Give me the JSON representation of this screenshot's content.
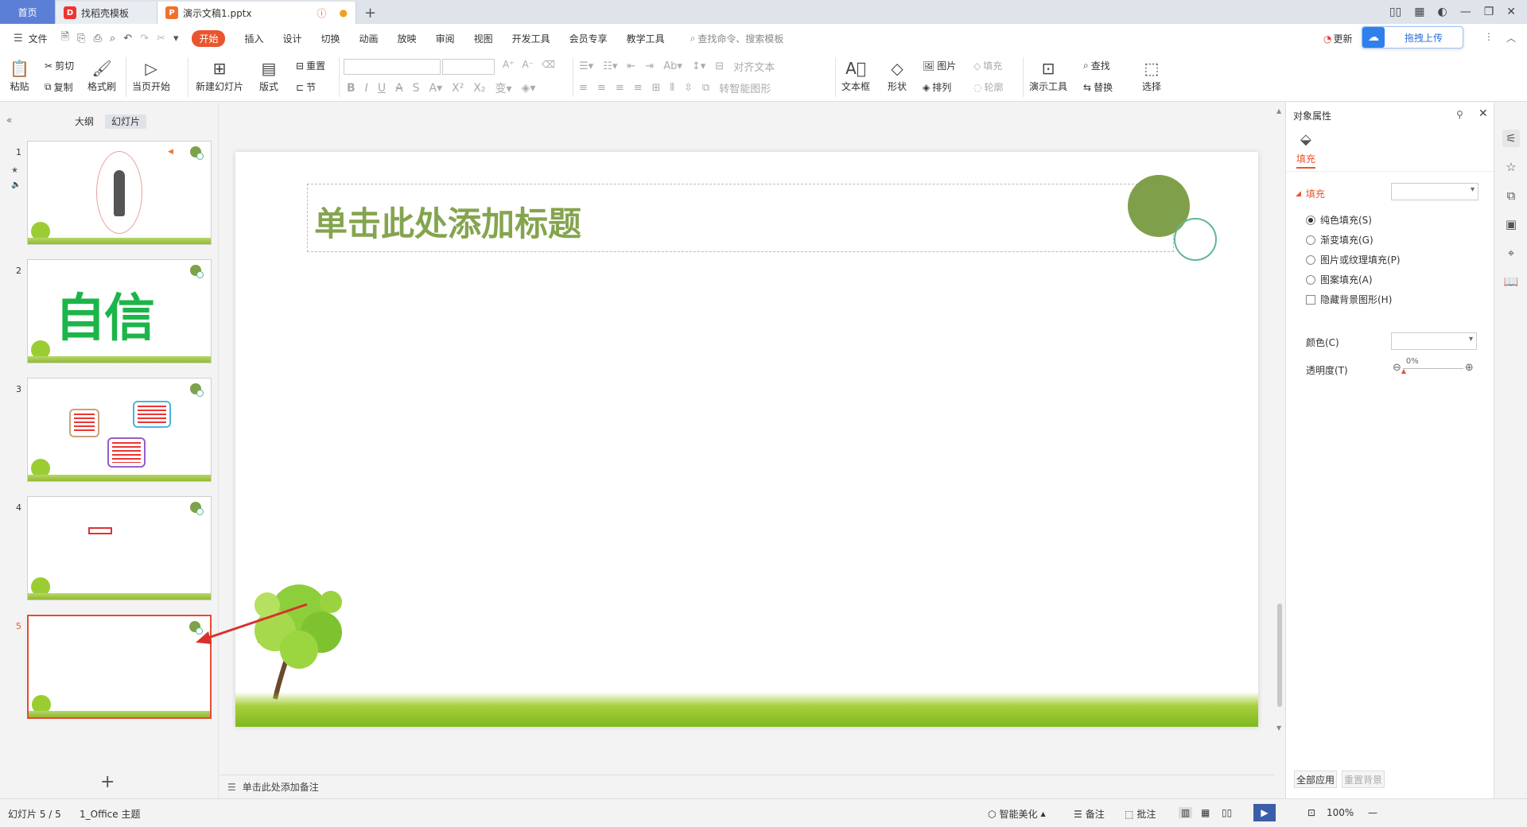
{
  "tabs": {
    "home": "首页",
    "template": "找稻壳模板",
    "doc": "演示文稿1.pptx"
  },
  "menu": {
    "file": "文件",
    "items": [
      "开始",
      "插入",
      "设计",
      "切换",
      "动画",
      "放映",
      "审阅",
      "视图",
      "开发工具",
      "会员专享",
      "教学工具"
    ],
    "search": "查找命令、搜索模板",
    "update": "更新",
    "upload": "拖拽上传"
  },
  "ribbon": {
    "paste": "粘贴",
    "cut": "剪切",
    "copy": "复制",
    "format_painter": "格式刷",
    "play_current": "当页开始",
    "new_slide": "新建幻灯片",
    "layout": "版式",
    "section": "节",
    "reset": "重置",
    "align_text": "对齐文本",
    "convert_smartart": "转智能图形",
    "textbox": "文本框",
    "shape": "形状",
    "picture": "图片",
    "arrange": "排列",
    "fill": "填充",
    "outline": "轮廓",
    "present_tool": "演示工具",
    "find": "查找",
    "replace": "替换",
    "select": "选择"
  },
  "left_pane": {
    "outline_tab": "大纲",
    "slides_tab": "幻灯片",
    "slide_numbers": [
      "1",
      "2",
      "3",
      "4",
      "5"
    ],
    "slide2_text": "自信",
    "add": "+"
  },
  "slide": {
    "title_placeholder": "单击此处添加标题"
  },
  "notes": {
    "placeholder": "单击此处添加备注"
  },
  "right_panel": {
    "title": "对象属性",
    "fill_tab": "填充",
    "section": "填充",
    "options": [
      "纯色填充(S)",
      "渐变填充(G)",
      "图片或纹理填充(P)",
      "图案填充(A)"
    ],
    "hide_bg": "隐藏背景图形(H)",
    "color_label": "颜色(C)",
    "transparency_label": "透明度(T)",
    "transparency_value": "0%",
    "apply_all": "全部应用",
    "reset_bg": "重置背景"
  },
  "status": {
    "slide_count": "幻灯片 5 / 5",
    "theme": "1_Office 主题",
    "beautify": "智能美化",
    "notes": "备注",
    "comment": "批注",
    "zoom": "100%"
  },
  "colors": {
    "accent": "#e8552f",
    "title_green": "#84a44e",
    "circle": "#809f4b",
    "ring": "#5fb894",
    "arrow": "#d9302c"
  }
}
